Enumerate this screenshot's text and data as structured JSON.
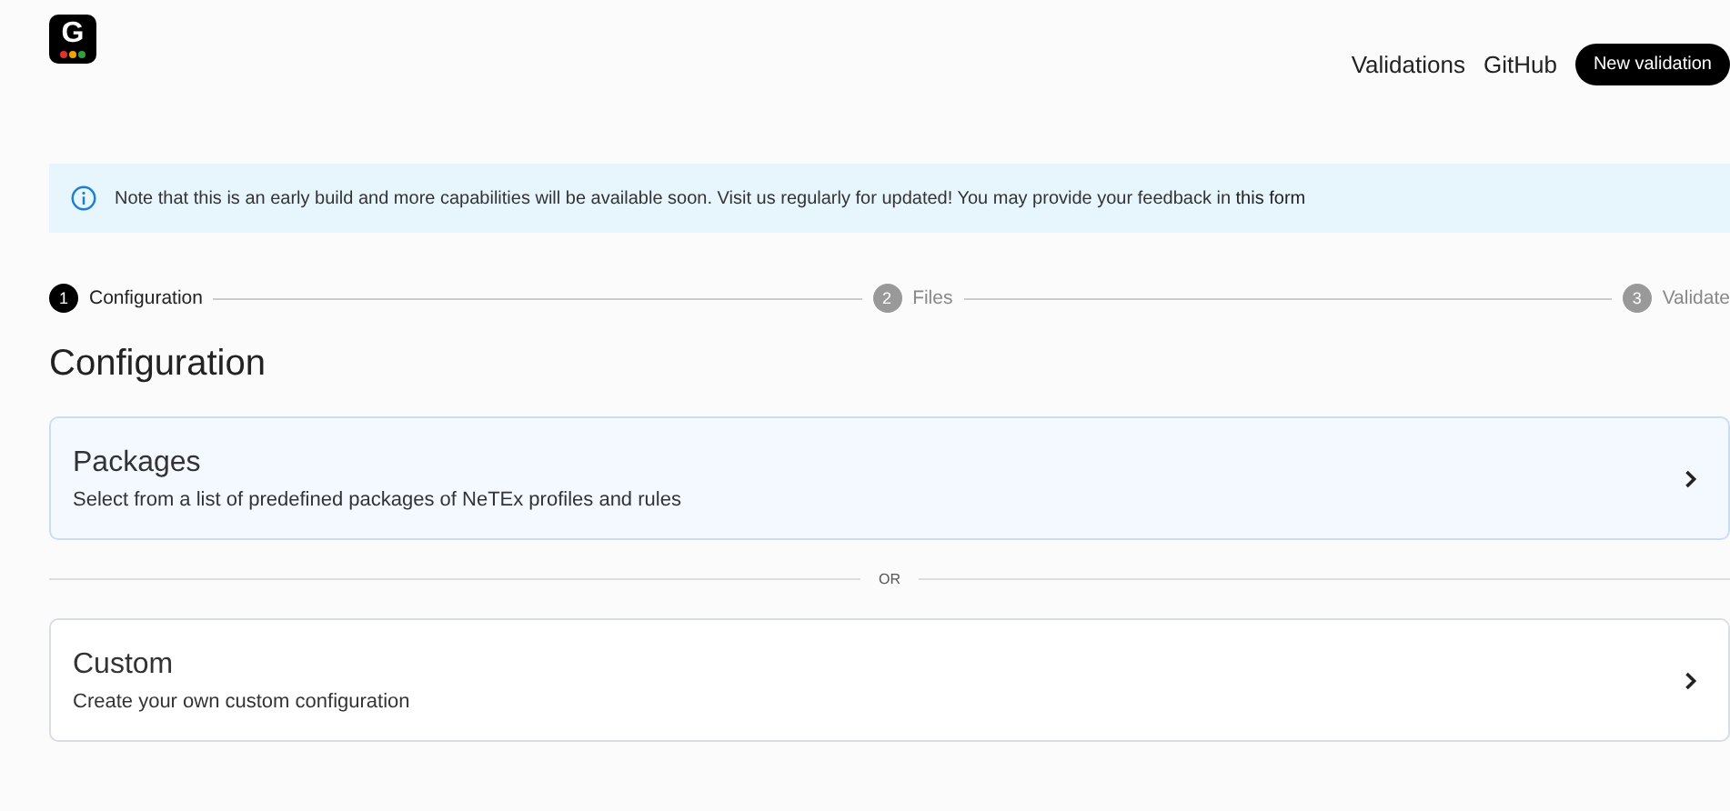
{
  "logo": {
    "letter": "G"
  },
  "nav": {
    "links": [
      "Validations",
      "GitHub"
    ],
    "button": "New validation"
  },
  "notice": {
    "text": "Note that this is an early build and more capabilities will be available soon. Visit us regularly for updated! You may provide your feedback in",
    "link": "this form"
  },
  "steps": [
    {
      "number": "1",
      "label": "Configuration",
      "selected": true
    },
    {
      "number": "2",
      "label": "Files",
      "selected": false
    },
    {
      "number": "3",
      "label": "Validate",
      "selected": false
    }
  ],
  "heading": "Configuration",
  "options": [
    {
      "title": "Packages",
      "description": "Select from a list of predefined packages of NeTEx profiles and rules",
      "selected": true
    },
    {
      "title": "Custom",
      "description": "Create your own custom configuration",
      "selected": false
    }
  ],
  "separator": "OR"
}
